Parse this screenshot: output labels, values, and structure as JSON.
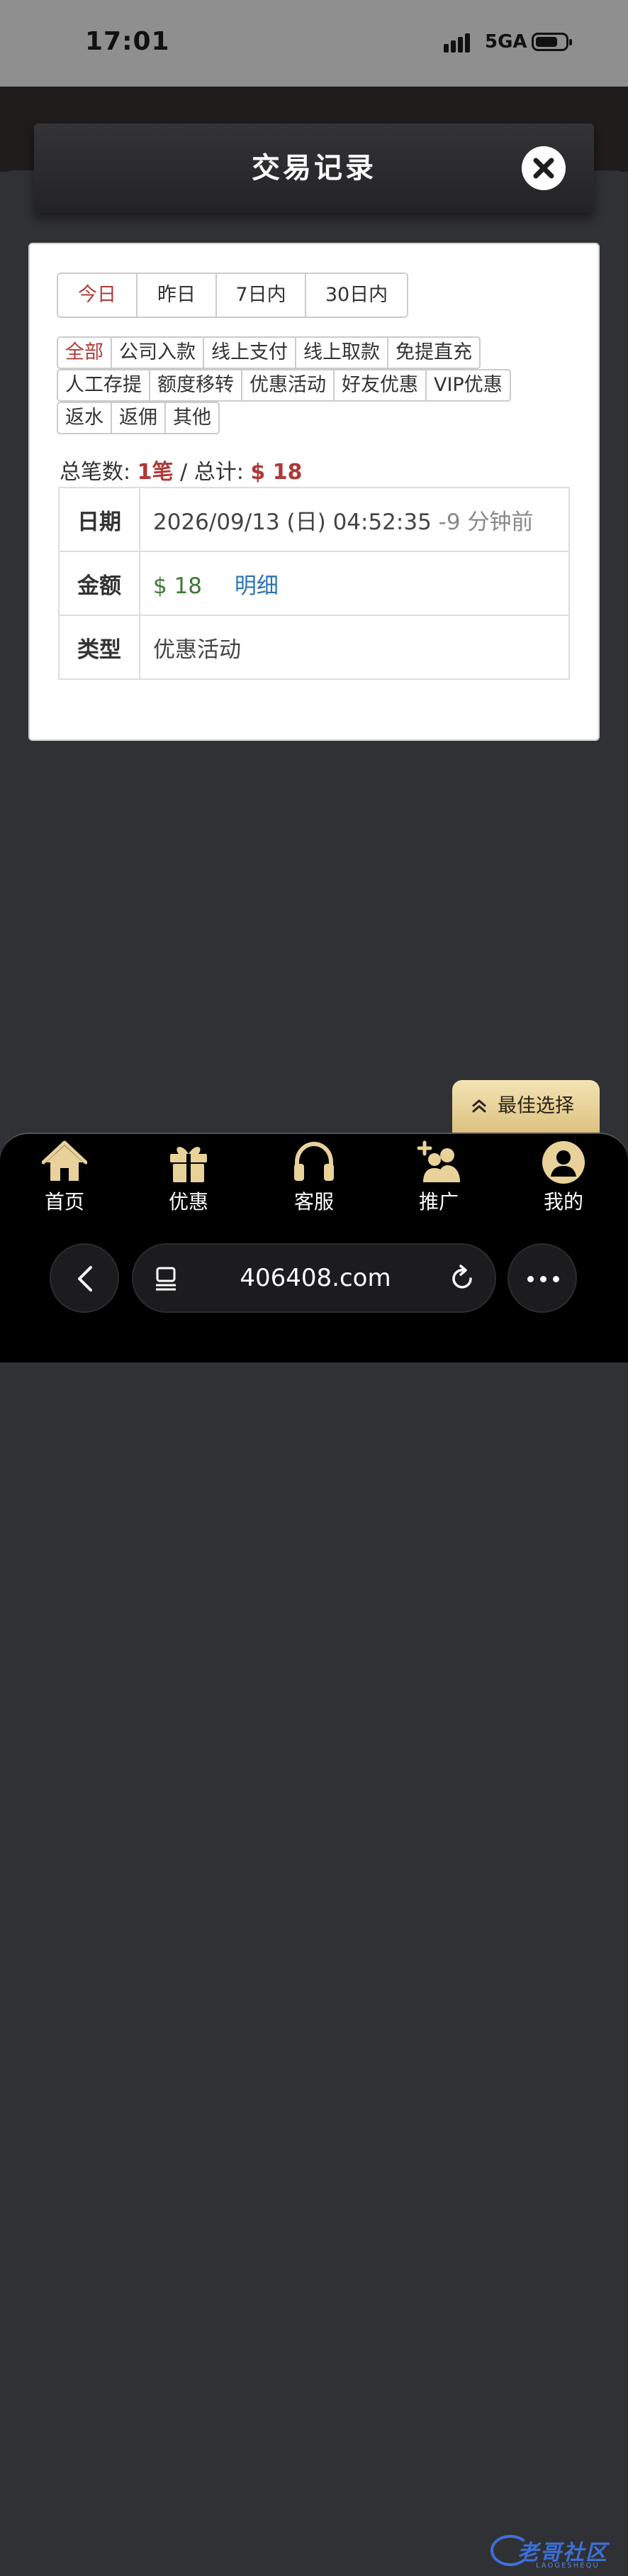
{
  "status_bar": {
    "time": "17:01",
    "network": "5GA"
  },
  "modal": {
    "title": "交易记录"
  },
  "date_tabs": [
    "今日",
    "昨日",
    "7日内",
    "30日内"
  ],
  "date_tab_active": "今日",
  "filter_rows": [
    [
      "全部",
      "公司入款",
      "线上支付",
      "线上取款",
      "免提直充"
    ],
    [
      "人工存提",
      "额度移转",
      "优惠活动",
      "好友优惠",
      "VIP优惠"
    ],
    [
      "返水",
      "返佣",
      "其他"
    ]
  ],
  "filter_active": "全部",
  "summary": {
    "count_label": "总笔数:",
    "count_value": "1笔",
    "separator": "/",
    "total_label": "总计:",
    "total_value": "$ 18"
  },
  "record": {
    "date_label": "日期",
    "date_value": "2026/09/13 (日) 04:52:35",
    "date_ago": "-9 分钟前",
    "amount_label": "金额",
    "amount_value": "$ 18",
    "detail_link": "明细",
    "type_label": "类型",
    "type_value": "优惠活动"
  },
  "float_button": {
    "label": "最佳选择"
  },
  "bottom_nav": [
    {
      "label": "首页",
      "icon": "home-icon"
    },
    {
      "label": "优惠",
      "icon": "gift-icon"
    },
    {
      "label": "客服",
      "icon": "headset-icon"
    },
    {
      "label": "推广",
      "icon": "add-user-icon"
    },
    {
      "label": "我的",
      "icon": "profile-icon"
    }
  ],
  "browser": {
    "url": "406408.com"
  },
  "watermark": {
    "text": "老哥社区",
    "sub": "LAOGESHEQU"
  },
  "colors": {
    "accent_red": "#b03838",
    "gold": "#e8d299",
    "green": "#3b7a34",
    "link_blue": "#2f73b3"
  }
}
